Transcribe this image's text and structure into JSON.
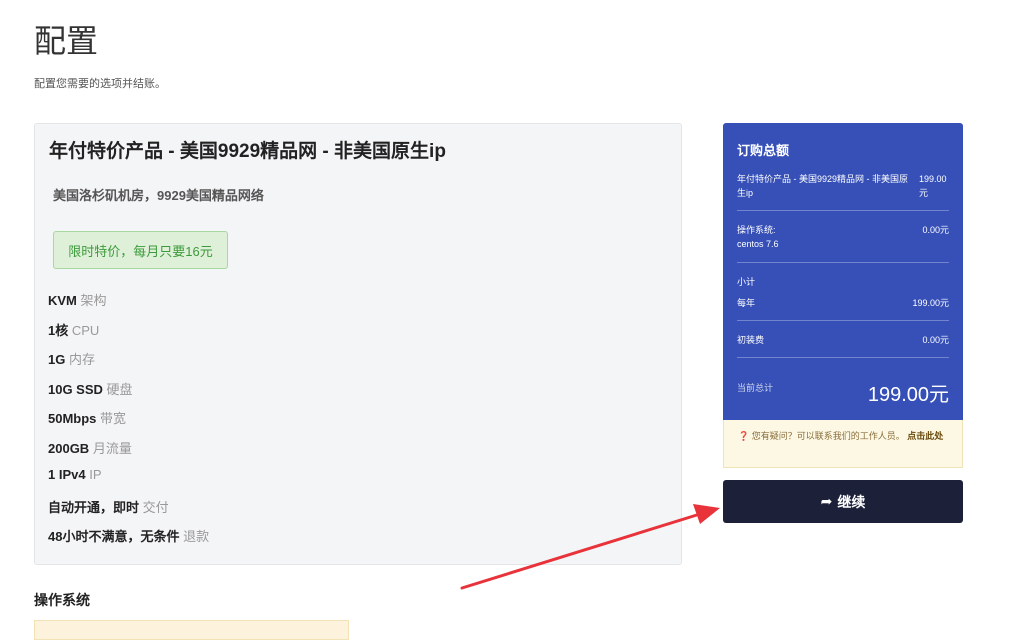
{
  "page": {
    "title": "配置",
    "subtitle": "配置您需要的选项并结账。"
  },
  "product": {
    "name": "年付特价产品 - 美国9929精品网 - 非美国原生ip",
    "description": "美国洛杉矶机房，9929美国精品网络",
    "promo": "限时特价，每月只要16元",
    "specs": [
      {
        "bold": "KVM",
        "light": "架构"
      },
      {
        "bold": "1核",
        "light": "CPU"
      },
      {
        "bold": "1G",
        "light": "内存"
      },
      {
        "bold": "10G SSD",
        "light": "硬盘"
      },
      {
        "bold": "50Mbps",
        "light": "带宽"
      },
      {
        "bold": "200GB",
        "light": "月流量"
      },
      {
        "bold": "1 IPv4",
        "light": "IP"
      },
      {
        "bold": "自动开通，即时",
        "light": "交付"
      },
      {
        "bold": "48小时不满意，无条件",
        "light": "退款"
      }
    ]
  },
  "sections": {
    "os": "操作系统"
  },
  "summary": {
    "title": "订购总额",
    "product_line": "年付特价产品 - 美国9929精品网 - 非美国原生ip",
    "product_price": "199.00元",
    "os_label": "操作系统:",
    "os_value": "centos 7.6",
    "os_price": "0.00元",
    "subtotal_label": "小计",
    "period_label": "每年",
    "period_price": "199.00元",
    "setup_label": "初装费",
    "setup_price": "0.00元",
    "total_label": "当前总计",
    "total_amount": "199.00元"
  },
  "help": {
    "text": "您有疑问？可以联系我们的工作人员。",
    "link": "点击此处"
  },
  "actions": {
    "continue": "继续"
  },
  "icons": {
    "help": "question-circle-icon",
    "continue": "share-arrow-icon"
  },
  "colors": {
    "summary_bg": "#3650b8",
    "continue_bg": "#1c2039",
    "promo_bg": "#dff0d8",
    "annotation_arrow": "#e8333a"
  }
}
